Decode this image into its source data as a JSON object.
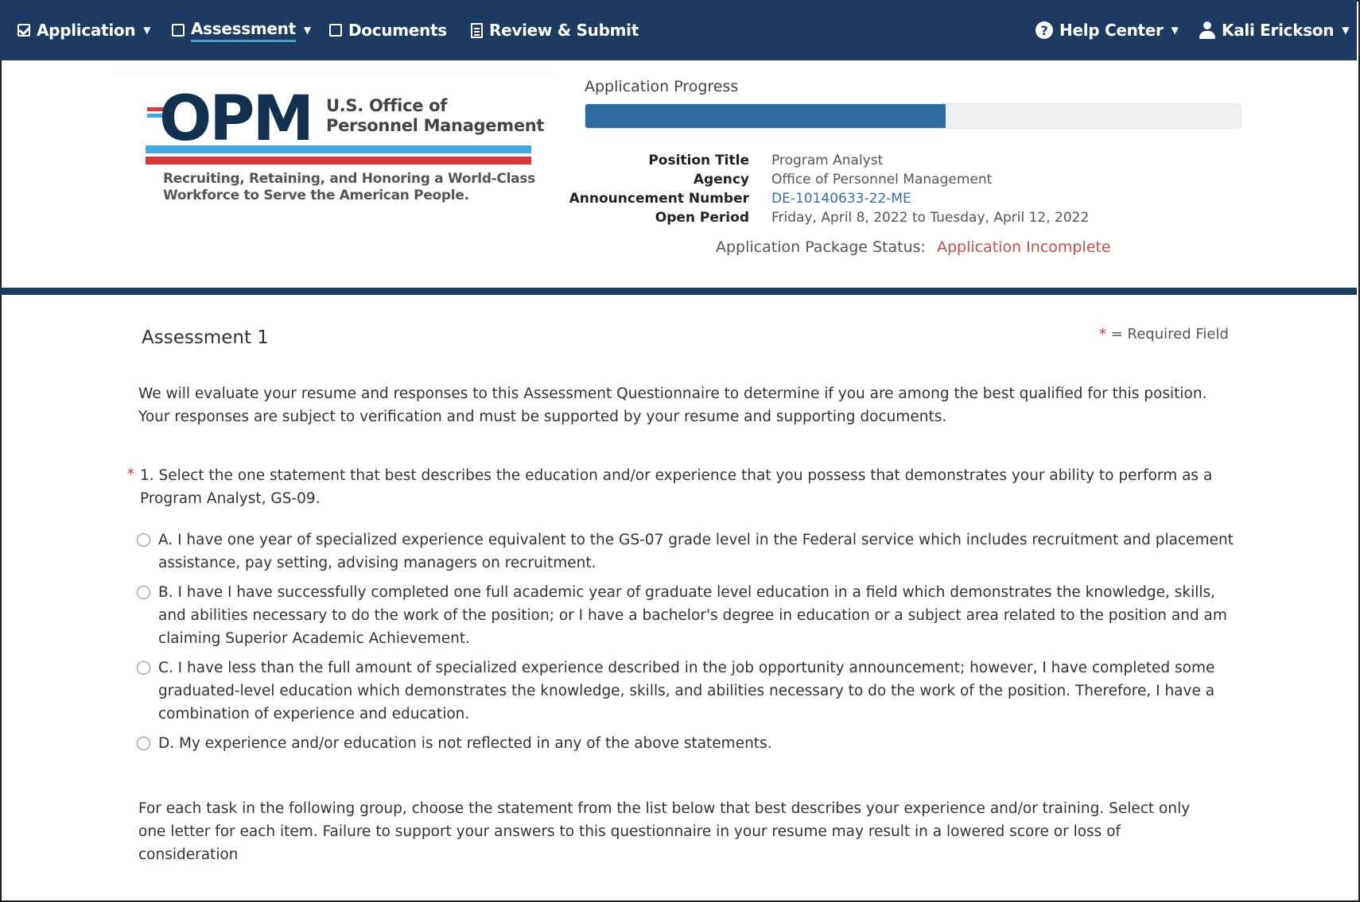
{
  "nav": {
    "application": "Application",
    "assessment": "Assessment",
    "documents": "Documents",
    "review": "Review & Submit",
    "help": "Help Center",
    "user": "Kali Erickson"
  },
  "logo": {
    "mark": "OPM",
    "line1": "U.S. Office of",
    "line2": "Personnel Management",
    "tagline1": "Recruiting, Retaining, and Honoring a World-Class",
    "tagline2": "Workforce to Serve the American People."
  },
  "progress": {
    "label": "Application Progress",
    "fraction": 0.55
  },
  "info": {
    "position_title_label": "Position Title",
    "position_title": "Program Analyst",
    "agency_label": "Agency",
    "agency": "Office of Personnel Management",
    "announcement_label": "Announcement Number",
    "announcement": "DE-10140633-22-ME",
    "open_period_label": "Open Period",
    "open_period": "Friday, April 8, 2022 to Tuesday, April 12, 2022",
    "status_label": "Application Package Status:",
    "status": "Application Incomplete"
  },
  "assessment": {
    "title": "Assessment 1",
    "required_star": "*",
    "required_text": "= Required Field",
    "intro1": "We will evaluate your resume and responses to this Assessment Questionnaire to determine if you are among the best qualified for this position.",
    "intro2": "Your responses are subject to verification and must be supported by your resume and supporting documents.",
    "q_star": "*",
    "q1_line1": "1.  Select the one statement that best describes the education and/or experience that you possess that demonstrates your ability to perform as a",
    "q1_line2": "Program Analyst, GS-09.",
    "options": [
      "A. I have one year of specialized experience equivalent to the GS-07 grade level in the Federal service which includes recruitment and placement assistance, pay setting, advising managers on recruitment.",
      "B. I have I have successfully completed one full academic year of graduate level education in a field which demonstrates the knowledge, skills, and abilities necessary to do the work of the position; or I have a bachelor's degree in education or a subject area related to the position and am claiming Superior Academic Achievement.",
      "C. I have less than the full amount of specialized experience described in the job opportunity announcement; however, I have completed some graduated-level education which demonstrates the knowledge, skills, and abilities necessary to do the work of the position. Therefore, I have a combination of experience and education.",
      "D. My experience and/or education is not reflected in any of the above statements."
    ],
    "task_intro": "For each task in the following group, choose the statement from the list below that best describes your experience and/or training. Select only one letter for each item. Failure to support your answers to this questionnaire in your resume may result in a lowered score or loss of consideration"
  },
  "colors": {
    "nav_bg": "#1e3a5f",
    "progress_fill": "#2c6ba0",
    "status_red": "#c0504d",
    "link_blue": "#3a6ea5"
  }
}
